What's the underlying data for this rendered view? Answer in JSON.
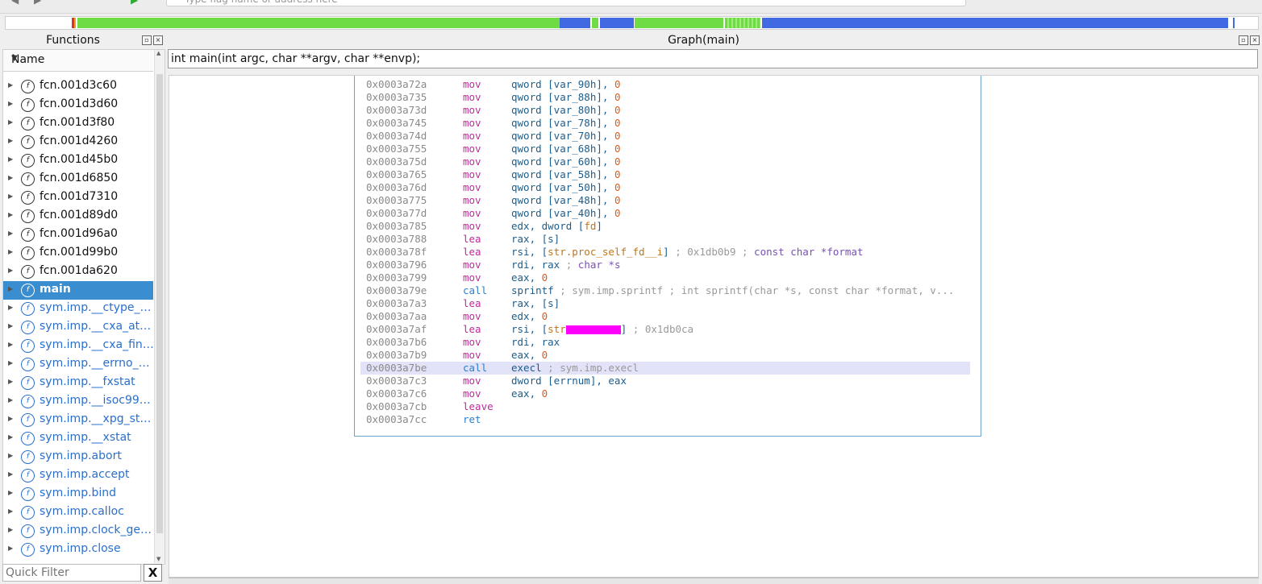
{
  "toolbar": {
    "search_placeholder": "Type flag name or address here"
  },
  "overview_colors": {
    "code": "#6fdc45",
    "data": "#4169e1",
    "marker": "#e03030"
  },
  "functions_panel": {
    "title": "Functions",
    "column_header": "Name",
    "items": [
      {
        "label": "fcn.001d3c60",
        "kind": "fcn"
      },
      {
        "label": "fcn.001d3d60",
        "kind": "fcn"
      },
      {
        "label": "fcn.001d3f80",
        "kind": "fcn"
      },
      {
        "label": "fcn.001d4260",
        "kind": "fcn"
      },
      {
        "label": "fcn.001d45b0",
        "kind": "fcn"
      },
      {
        "label": "fcn.001d6850",
        "kind": "fcn"
      },
      {
        "label": "fcn.001d7310",
        "kind": "fcn"
      },
      {
        "label": "fcn.001d89d0",
        "kind": "fcn"
      },
      {
        "label": "fcn.001d96a0",
        "kind": "fcn"
      },
      {
        "label": "fcn.001d99b0",
        "kind": "fcn"
      },
      {
        "label": "fcn.001da620",
        "kind": "fcn"
      },
      {
        "label": "main",
        "kind": "selected"
      },
      {
        "label": "sym.imp.__ctype_…",
        "kind": "imp"
      },
      {
        "label": "sym.imp.__cxa_at…",
        "kind": "imp"
      },
      {
        "label": "sym.imp.__cxa_fin…",
        "kind": "imp"
      },
      {
        "label": "sym.imp.__errno_…",
        "kind": "imp"
      },
      {
        "label": "sym.imp.__fxstat",
        "kind": "imp"
      },
      {
        "label": "sym.imp.__isoc99…",
        "kind": "imp"
      },
      {
        "label": "sym.imp.__xpg_st…",
        "kind": "imp"
      },
      {
        "label": "sym.imp.__xstat",
        "kind": "imp"
      },
      {
        "label": "sym.imp.abort",
        "kind": "imp"
      },
      {
        "label": "sym.imp.accept",
        "kind": "imp"
      },
      {
        "label": "sym.imp.bind",
        "kind": "imp"
      },
      {
        "label": "sym.imp.calloc",
        "kind": "imp"
      },
      {
        "label": "sym.imp.clock_ge…",
        "kind": "imp"
      },
      {
        "label": "sym.imp.close",
        "kind": "imp"
      }
    ],
    "filter_placeholder": "Quick Filter",
    "filter_clear": "X"
  },
  "graph_panel": {
    "title": "Graph(main)",
    "signature": "int main(int argc, char **argv, char **envp);",
    "highlighted_address": "0x0003a7be",
    "instructions": [
      {
        "addr": "0x0003a72a",
        "mn": "mov",
        "op": "qword [var_90h], ",
        "num": "0"
      },
      {
        "addr": "0x0003a735",
        "mn": "mov",
        "op": "qword [var_88h], ",
        "num": "0"
      },
      {
        "addr": "0x0003a73d",
        "mn": "mov",
        "op": "qword [var_80h], ",
        "num": "0"
      },
      {
        "addr": "0x0003a745",
        "mn": "mov",
        "op": "qword [var_78h], ",
        "num": "0"
      },
      {
        "addr": "0x0003a74d",
        "mn": "mov",
        "op": "qword [var_70h], ",
        "num": "0"
      },
      {
        "addr": "0x0003a755",
        "mn": "mov",
        "op": "qword [var_68h], ",
        "num": "0"
      },
      {
        "addr": "0x0003a75d",
        "mn": "mov",
        "op": "qword [var_60h], ",
        "num": "0"
      },
      {
        "addr": "0x0003a765",
        "mn": "mov",
        "op": "qword [var_58h], ",
        "num": "0"
      },
      {
        "addr": "0x0003a76d",
        "mn": "mov",
        "op": "qword [var_50h], ",
        "num": "0"
      },
      {
        "addr": "0x0003a775",
        "mn": "mov",
        "op": "qword [var_48h], ",
        "num": "0"
      },
      {
        "addr": "0x0003a77d",
        "mn": "mov",
        "op": "qword [var_40h], ",
        "num": "0"
      },
      {
        "addr": "0x0003a785",
        "mn": "mov",
        "op": "edx, dword [",
        "strref": "fd",
        "tail": "]"
      },
      {
        "addr": "0x0003a788",
        "mn": "lea",
        "op": "rax, [s]"
      },
      {
        "addr": "0x0003a78f",
        "mn": "lea",
        "op": "rsi, [",
        "strref": "str.proc_self_fd__i",
        "tail": "]",
        "comment": " ; 0x1db0b9 ; ",
        "ctype": "const char *format"
      },
      {
        "addr": "0x0003a796",
        "mn": "mov",
        "op": "rdi, rax",
        "comment": "   ; ",
        "ctype": "char *s"
      },
      {
        "addr": "0x0003a799",
        "mn": "mov",
        "op": "eax, ",
        "num": "0"
      },
      {
        "addr": "0x0003a79e",
        "mn": "call",
        "op": "sprintf",
        "comment": "    ; sym.imp.sprintf ; int sprintf(char *s, const char *format, v..."
      },
      {
        "addr": "0x0003a7a3",
        "mn": "lea",
        "op": "rax, [s]"
      },
      {
        "addr": "0x0003a7aa",
        "mn": "mov",
        "op": "edx, ",
        "num": "0"
      },
      {
        "addr": "0x0003a7af",
        "mn": "lea",
        "op": "rsi, [",
        "strref": "str",
        "redacted": true,
        "tail": "]",
        "comment": " ; 0x1db0ca"
      },
      {
        "addr": "0x0003a7b6",
        "mn": "mov",
        "op": "rdi, rax"
      },
      {
        "addr": "0x0003a7b9",
        "mn": "mov",
        "op": "eax, ",
        "num": "0"
      },
      {
        "addr": "0x0003a7be",
        "mn": "call",
        "op": "execl",
        "comment": "      ; sym.imp.execl"
      },
      {
        "addr": "0x0003a7c3",
        "mn": "mov",
        "op": "dword [errnum], eax"
      },
      {
        "addr": "0x0003a7c6",
        "mn": "mov",
        "op": "eax, ",
        "num": "0"
      },
      {
        "addr": "0x0003a7cb",
        "mn": "leave",
        "op": ""
      },
      {
        "addr": "0x0003a7cc",
        "mn": "ret",
        "op": ""
      }
    ]
  }
}
